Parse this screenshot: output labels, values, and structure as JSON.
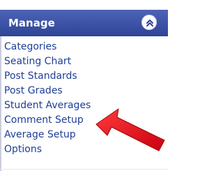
{
  "panel": {
    "title": "Manage",
    "collapse_icon": "double-chevron-up-icon"
  },
  "menu": {
    "items": [
      {
        "label": "Categories"
      },
      {
        "label": "Seating Chart"
      },
      {
        "label": "Post Standards"
      },
      {
        "label": "Post Grades"
      },
      {
        "label": "Student Averages"
      },
      {
        "label": "Comment Setup"
      },
      {
        "label": "Average Setup"
      },
      {
        "label": "Options"
      }
    ]
  },
  "annotation": {
    "icon": "red-arrow-icon",
    "color": "#e8141c"
  },
  "colors": {
    "header": "#2e4496",
    "link": "#1f3f97"
  }
}
